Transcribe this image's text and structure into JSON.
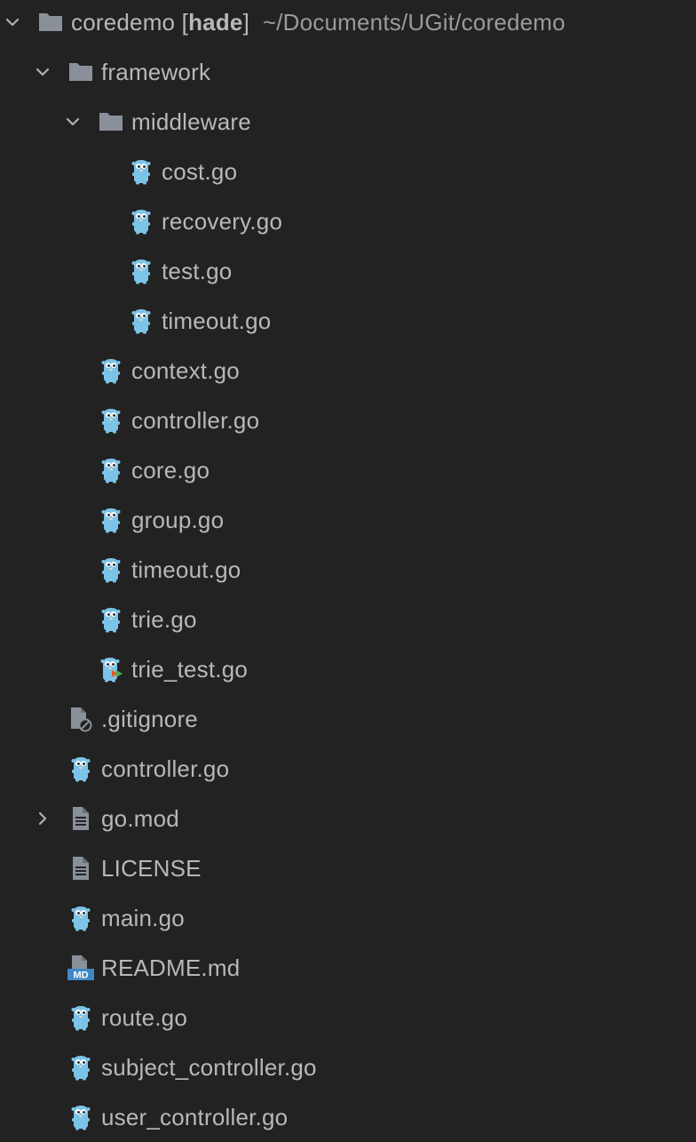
{
  "project": {
    "name": "coredemo",
    "branch_open": " [",
    "branch": "hade",
    "branch_close": "]",
    "path": "~/Documents/UGit/coredemo"
  },
  "colors": {
    "background": "#222222",
    "text": "#b8b8b8",
    "folder": "#8a9099",
    "gopher": "#7cc3e8",
    "md_badge": "#3f88c5"
  },
  "tree": [
    {
      "label": "framework",
      "icon": "folder-icon",
      "arrow": "expanded",
      "depth": 1
    },
    {
      "label": "middleware",
      "icon": "folder-icon",
      "arrow": "expanded",
      "depth": 2
    },
    {
      "label": "cost.go",
      "icon": "go-file-icon",
      "arrow": "none",
      "depth": 3
    },
    {
      "label": "recovery.go",
      "icon": "go-file-icon",
      "arrow": "none",
      "depth": 3
    },
    {
      "label": "test.go",
      "icon": "go-file-icon",
      "arrow": "none",
      "depth": 3
    },
    {
      "label": "timeout.go",
      "icon": "go-file-icon",
      "arrow": "none",
      "depth": 3
    },
    {
      "label": "context.go",
      "icon": "go-file-icon",
      "arrow": "none",
      "depth": 2
    },
    {
      "label": "controller.go",
      "icon": "go-file-icon",
      "arrow": "none",
      "depth": 2
    },
    {
      "label": "core.go",
      "icon": "go-file-icon",
      "arrow": "none",
      "depth": 2
    },
    {
      "label": "group.go",
      "icon": "go-file-icon",
      "arrow": "none",
      "depth": 2
    },
    {
      "label": "timeout.go",
      "icon": "go-file-icon",
      "arrow": "none",
      "depth": 2
    },
    {
      "label": "trie.go",
      "icon": "go-file-icon",
      "arrow": "none",
      "depth": 2
    },
    {
      "label": "trie_test.go",
      "icon": "go-test-file-icon",
      "arrow": "none",
      "depth": 2
    },
    {
      "label": ".gitignore",
      "icon": "gitignore-file-icon",
      "arrow": "none",
      "depth": 1
    },
    {
      "label": "controller.go",
      "icon": "go-file-icon",
      "arrow": "none",
      "depth": 1
    },
    {
      "label": "go.mod",
      "icon": "text-file-icon",
      "arrow": "collapsed",
      "depth": 1
    },
    {
      "label": "LICENSE",
      "icon": "text-file-icon",
      "arrow": "none",
      "depth": 1
    },
    {
      "label": "main.go",
      "icon": "go-file-icon",
      "arrow": "none",
      "depth": 1
    },
    {
      "label": "README.md",
      "icon": "markdown-file-icon",
      "arrow": "none",
      "depth": 1
    },
    {
      "label": "route.go",
      "icon": "go-file-icon",
      "arrow": "none",
      "depth": 1
    },
    {
      "label": "subject_controller.go",
      "icon": "go-file-icon",
      "arrow": "none",
      "depth": 1
    },
    {
      "label": "user_controller.go",
      "icon": "go-file-icon",
      "arrow": "none",
      "depth": 1
    }
  ]
}
